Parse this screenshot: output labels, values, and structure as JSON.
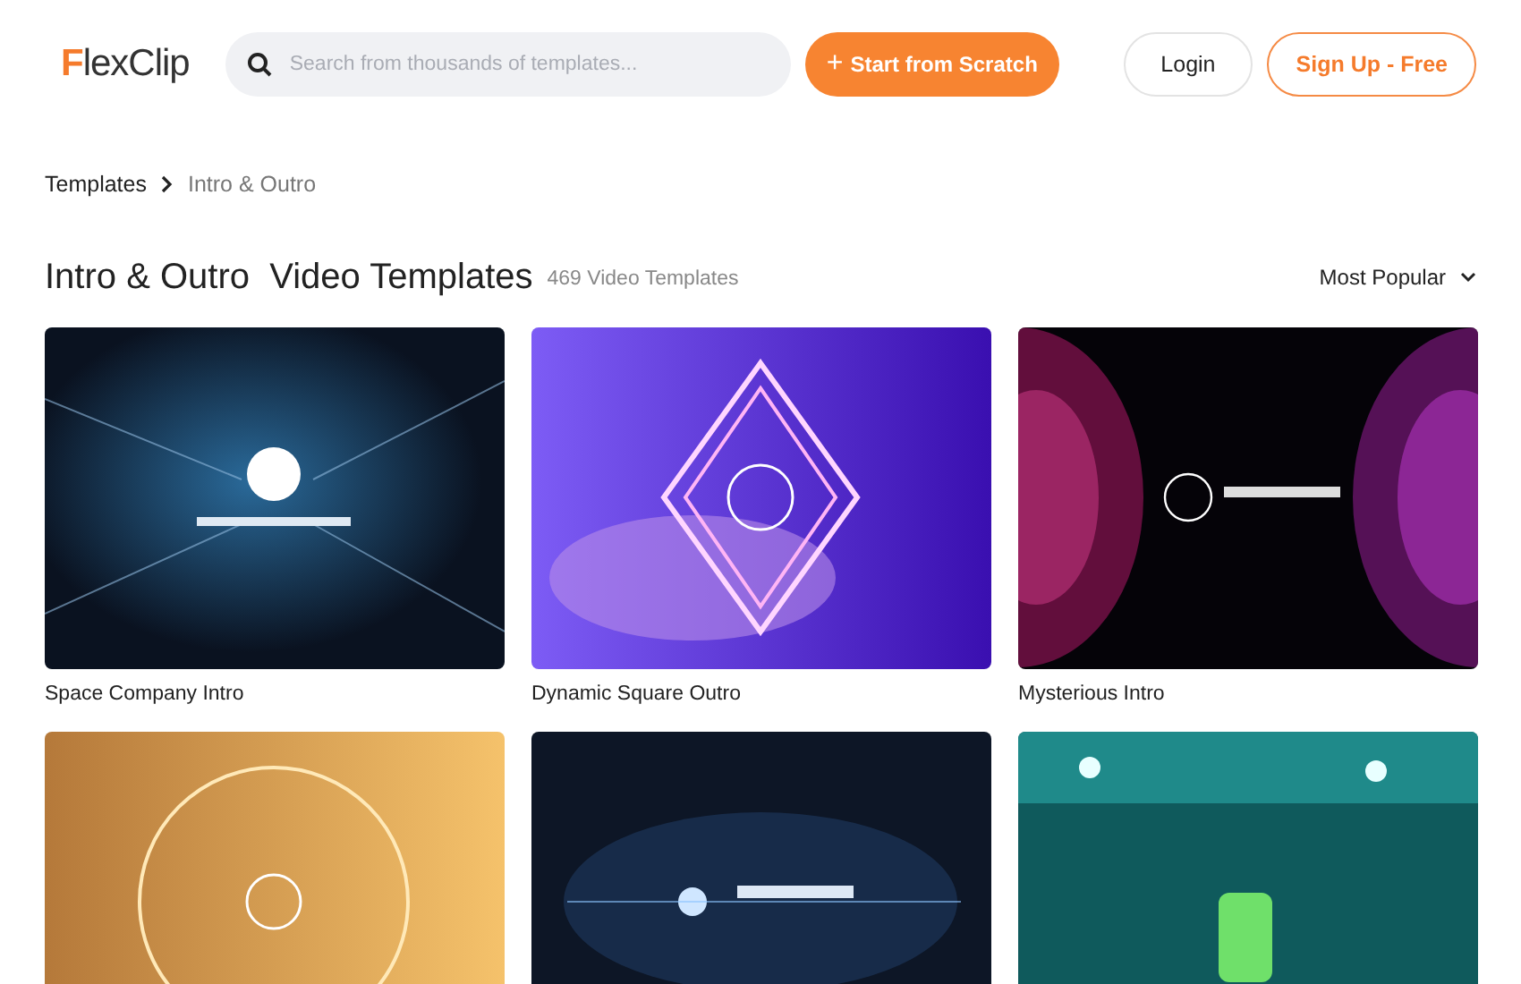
{
  "header": {
    "logo": "FlexClip",
    "search": {
      "placeholder": "Search from thousands of templates..."
    },
    "start_button": {
      "icon": "+",
      "label": "Start from Scratch"
    },
    "login": "Login",
    "signup": "Sign Up - Free"
  },
  "breadcrumb": [
    {
      "label": "Templates",
      "selected": false
    },
    {
      "label": "Intro & Outro",
      "selected": true
    }
  ],
  "heading": {
    "title": "Intro & Outro  Video Templates",
    "count": "469 Video Templates",
    "sort": "Most Popular"
  },
  "templates": [
    {
      "title": "Space Company Intro",
      "kind": "picture"
    },
    {
      "title": "Dynamic Square Outro",
      "kind": "picture"
    },
    {
      "title": "Mysterious Intro",
      "kind": "picture"
    },
    {
      "kind": "picture"
    },
    {
      "kind": "picture"
    },
    {
      "kind": "picture"
    }
  ]
}
